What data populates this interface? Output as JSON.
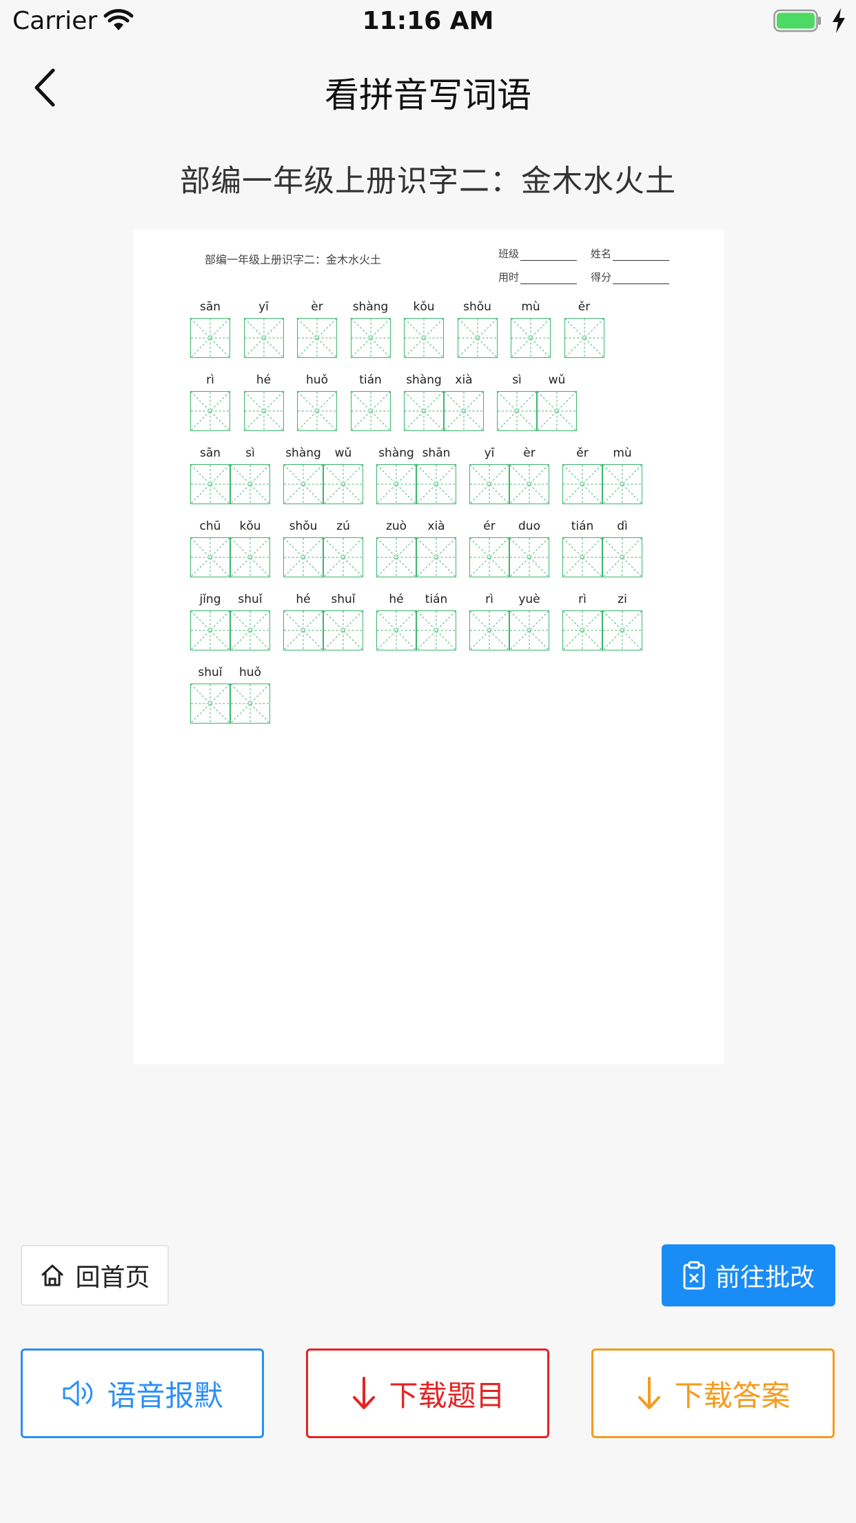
{
  "status_bar": {
    "carrier": "Carrier",
    "time": "11:16 AM",
    "battery_color": "#4cd964"
  },
  "nav": {
    "title": "看拼音写词语"
  },
  "sheet": {
    "title": "部编一年级上册识字二：金木水火土",
    "preview_header": "部编一年级上册识字二：金木水火土",
    "meta": {
      "class_label": "班级",
      "name_label": "姓名",
      "time_label": "用时",
      "score_label": "得分"
    },
    "rows": [
      [
        [
          "sān"
        ],
        [
          "yī"
        ],
        [
          "èr"
        ],
        [
          "shàng"
        ],
        [
          "kǒu"
        ],
        [
          "shǒu"
        ],
        [
          "mù"
        ],
        [
          "ěr"
        ]
      ],
      [
        [
          "rì"
        ],
        [
          "hé"
        ],
        [
          "huǒ"
        ],
        [
          "tián"
        ],
        [
          "shàng",
          "xià"
        ],
        [
          "sì",
          "wǔ"
        ]
      ],
      [
        [
          "sān",
          "sì"
        ],
        [
          "shàng",
          "wǔ"
        ],
        [
          "shàng",
          "shān"
        ],
        [
          "yī",
          "èr"
        ],
        [
          "ěr",
          "mù"
        ]
      ],
      [
        [
          "chū",
          "kǒu"
        ],
        [
          "shǒu",
          "zú"
        ],
        [
          "zuò",
          "xià"
        ],
        [
          "ér",
          "duo"
        ],
        [
          "tián",
          "dì"
        ]
      ],
      [
        [
          "jǐng",
          "shuǐ"
        ],
        [
          "hé",
          "shuǐ"
        ],
        [
          "hé",
          "tián"
        ],
        [
          "rì",
          "yuè"
        ],
        [
          "rì",
          "zi"
        ]
      ],
      [
        [
          "shuǐ",
          "huǒ"
        ]
      ]
    ]
  },
  "buttons": {
    "home": "回首页",
    "grade": "前往批改",
    "dictation": "语音报默",
    "download_questions": "下载题目",
    "download_answers": "下载答案"
  },
  "colors": {
    "blue": "#1a8cf5",
    "red": "#e62222",
    "orange": "#f59b1c",
    "grid_green": "#3bb46e"
  }
}
